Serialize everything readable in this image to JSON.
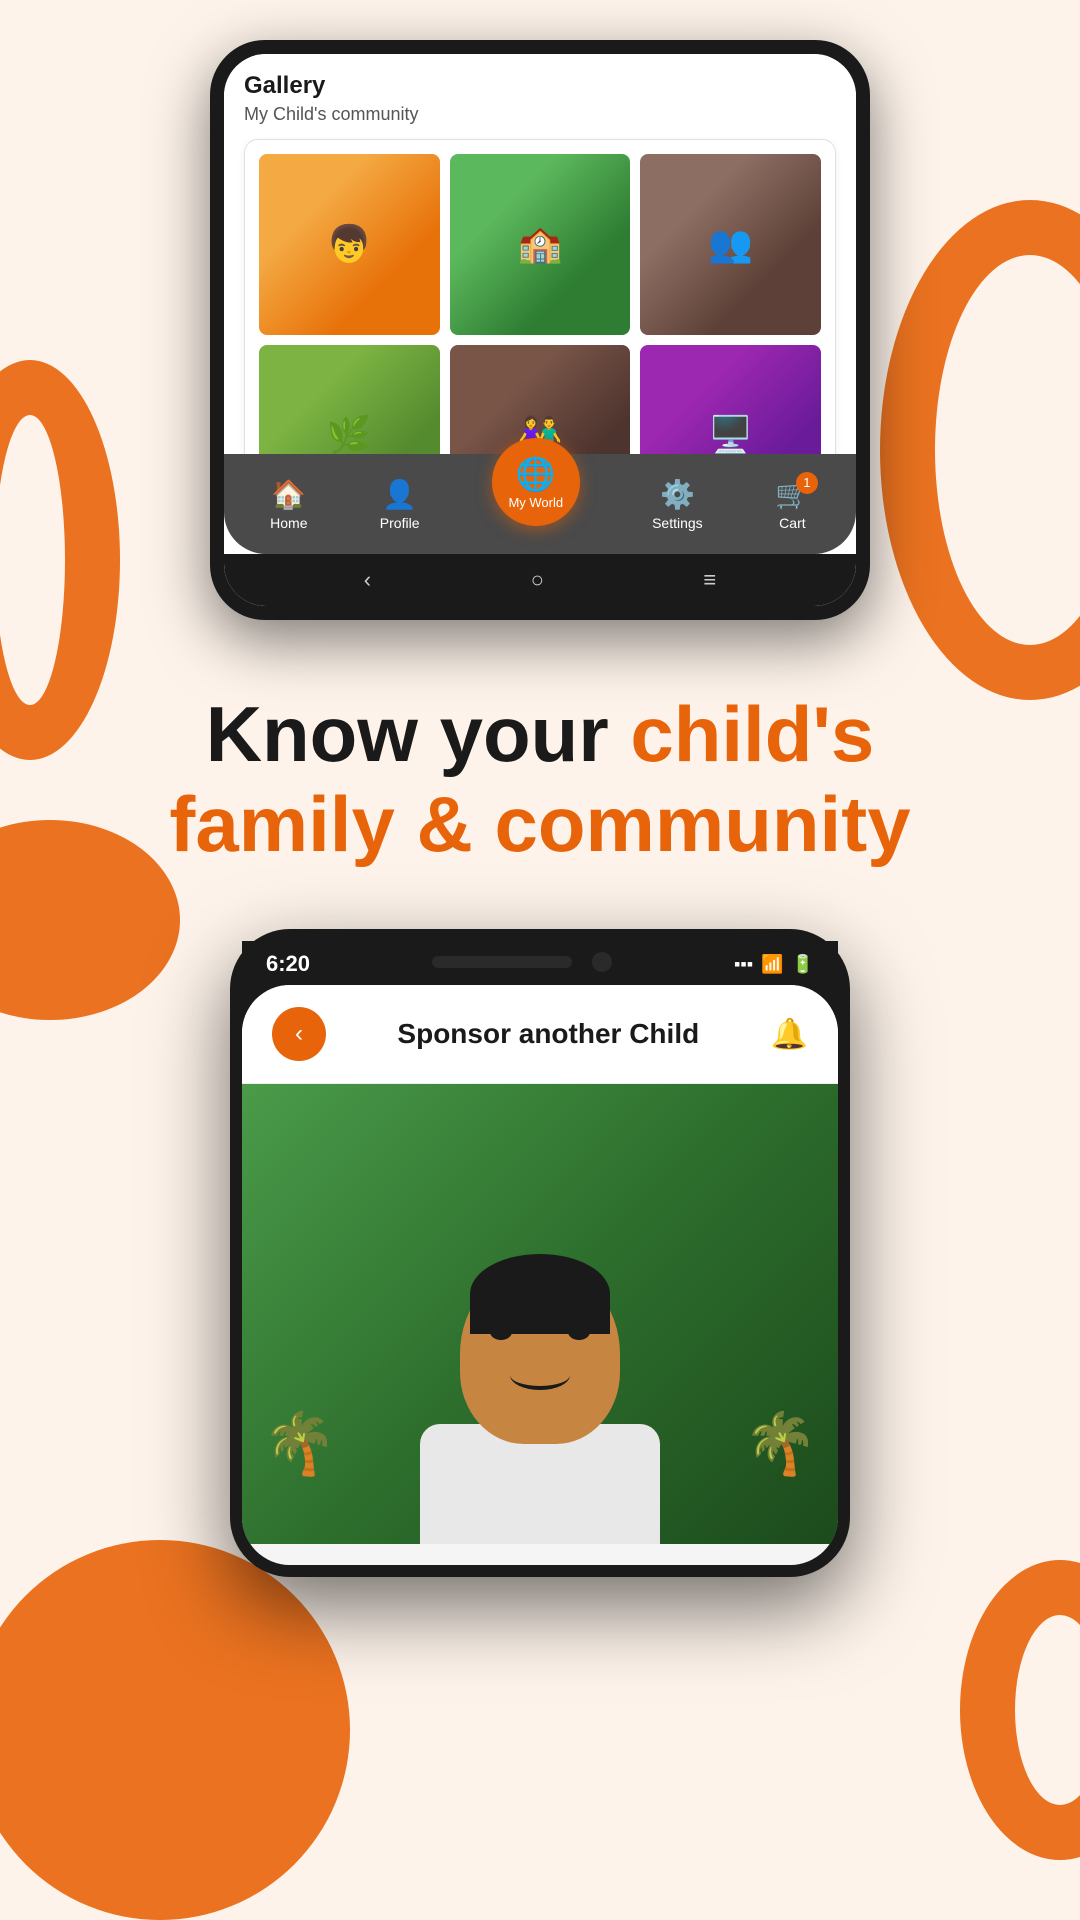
{
  "page": {
    "background_color": "#fdf3ea",
    "accent_color": "#e8640a"
  },
  "phone1": {
    "gallery": {
      "title": "Gallery",
      "subtitle": "My Child's community",
      "images": [
        {
          "id": 1,
          "alt": "child with painting",
          "class": "img-1"
        },
        {
          "id": 2,
          "alt": "community event",
          "class": "img-2"
        },
        {
          "id": 3,
          "alt": "group sitting",
          "class": "img-3"
        },
        {
          "id": 4,
          "alt": "outdoor activity",
          "class": "img-4"
        },
        {
          "id": 5,
          "alt": "children group",
          "class": "img-5"
        },
        {
          "id": 6,
          "alt": "indoor activity",
          "class": "img-6"
        }
      ]
    },
    "nav": {
      "items": [
        {
          "id": "home",
          "label": "Home",
          "icon": "🏠"
        },
        {
          "id": "profile",
          "label": "Profile",
          "icon": "👤"
        },
        {
          "id": "my-world",
          "label": "My World",
          "icon": "🌐",
          "active": true
        },
        {
          "id": "settings",
          "label": "Settings",
          "icon": "⚙️"
        },
        {
          "id": "cart",
          "label": "Cart",
          "icon": "🛒",
          "badge": "1"
        }
      ]
    }
  },
  "tagline": {
    "line1_normal": "Know your ",
    "line1_highlight": "child's",
    "line2_highlight": "family & community"
  },
  "phone2": {
    "status_bar": {
      "time": "6:20",
      "wifi_icon": "WiFi",
      "battery_icon": "Battery"
    },
    "header": {
      "back_icon": "‹",
      "title": "Sponsor another Child",
      "bell_icon": "🔔"
    },
    "child_photo": {
      "alt": "Smiling boy with palm trees in background"
    }
  }
}
